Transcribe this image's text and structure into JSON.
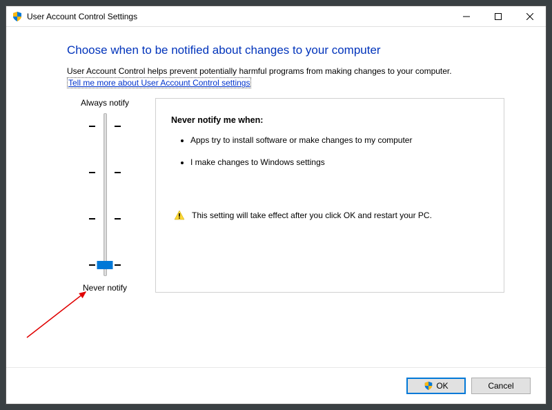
{
  "titlebar": {
    "title": "User Account Control Settings"
  },
  "heading": "Choose when to be notified about changes to your computer",
  "description": "User Account Control helps prevent potentially harmful programs from making changes to your computer.",
  "link_text": "Tell me more about User Account Control settings",
  "slider": {
    "label_top": "Always notify",
    "label_bottom": "Never notify"
  },
  "info": {
    "title": "Never notify me when:",
    "items": [
      "Apps try to install software or make changes to my computer",
      "I make changes to Windows settings"
    ],
    "warning": "This setting will take effect after you click OK and restart your PC."
  },
  "footer": {
    "ok": "OK",
    "cancel": "Cancel"
  }
}
